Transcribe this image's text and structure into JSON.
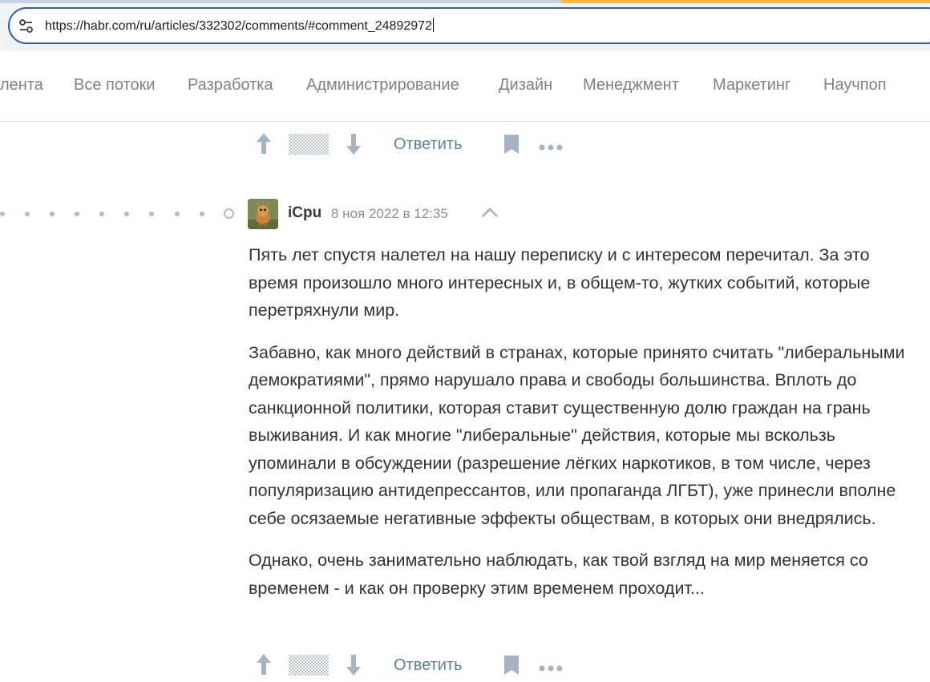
{
  "browser": {
    "url": "https://habr.com/ru/articles/332302/comments/#comment_24892972"
  },
  "nav": {
    "items": [
      "лента",
      "Все потоки",
      "Разработка",
      "Администрирование",
      "Дизайн",
      "Менеджмент",
      "Маркетинг",
      "Научпоп"
    ]
  },
  "top_actions": {
    "reply_label": "Ответить"
  },
  "comment": {
    "author": "iCpu",
    "timestamp": "8 ноя 2022 в 12:35",
    "paragraphs": [
      "Пять лет спустя налетел на нашу переписку и с интересом перечитал. За это время произошло много интересных и, в общем-то, жутких событий, которые перетряхнули мир.",
      "Забавно, как много действий в странах, которые принято считать \"либеральными демократиями\", прямо нарушало права и свободы большинства. Вплоть до санкционной политики, которая ставит существенную долю граждан на грань выживания. И как многие \"либеральные\" действия, которые мы вскользь упоминали в обсуждении (разрешение лёгких наркотиков, в том числе, через популяризацию антидепрессантов, или пропаганда ЛГБТ), уже принесли вполне себе осязаемые негативные эффекты обществам, в которых они внедрялись.",
      "Однако, очень занимательно наблюдать, как твой взгляд на мир меняется со временем - и как он проверку этим временем проходит..."
    ],
    "reply_label": "Ответить"
  },
  "icons": {
    "vote_up": "arrow-up-icon",
    "rating": "hidden-rating-icon",
    "vote_down": "arrow-down-icon",
    "bookmark": "bookmark-icon",
    "more": "more-icon",
    "collapse": "chevron-up-icon",
    "site_settings": "tune-icon"
  },
  "colors": {
    "link": "#5e7f9f",
    "nav_text": "#7b8389",
    "icon_gray": "#a7b4bf",
    "address_border": "#2f5fb8"
  }
}
